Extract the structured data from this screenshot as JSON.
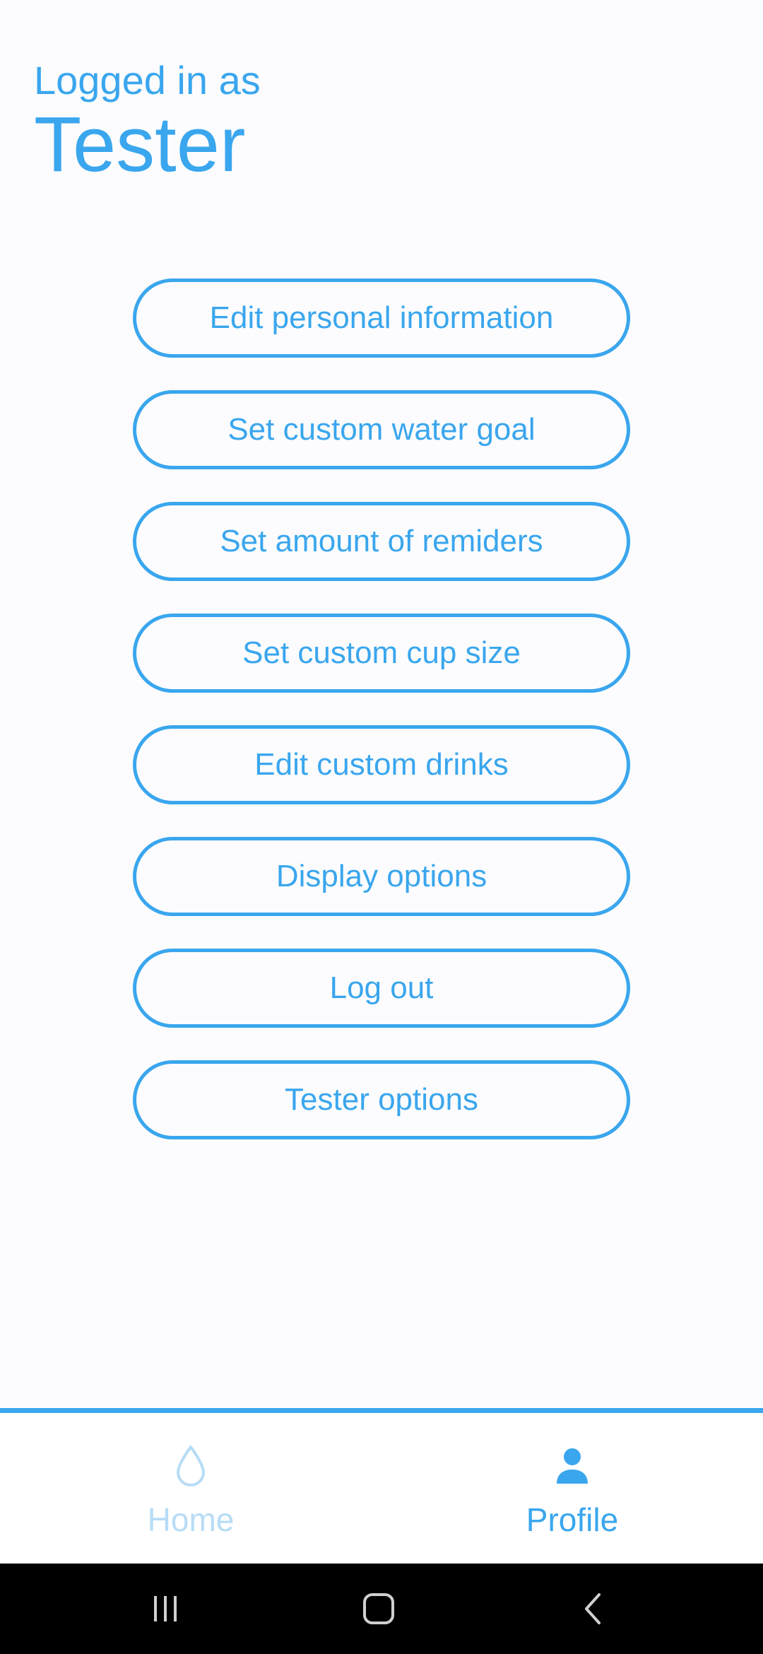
{
  "header": {
    "subtitle": "Logged in as",
    "username": "Tester"
  },
  "menu": {
    "items": [
      {
        "label": "Edit personal information"
      },
      {
        "label": "Set custom water goal"
      },
      {
        "label": "Set amount of remiders"
      },
      {
        "label": "Set custom cup size"
      },
      {
        "label": "Edit custom drinks"
      },
      {
        "label": "Display options"
      },
      {
        "label": "Log out"
      },
      {
        "label": "Tester options"
      }
    ]
  },
  "bottom_nav": {
    "items": [
      {
        "label": "Home",
        "icon": "water-drop-icon",
        "active": false
      },
      {
        "label": "Profile",
        "icon": "person-icon",
        "active": true
      }
    ]
  },
  "system_nav": {
    "buttons": [
      "recent-apps-icon",
      "home-icon",
      "back-icon"
    ]
  },
  "colors": {
    "accent": "#3aa6ee",
    "inactive": "#b7dcf6",
    "background": "#fcfcfe"
  }
}
